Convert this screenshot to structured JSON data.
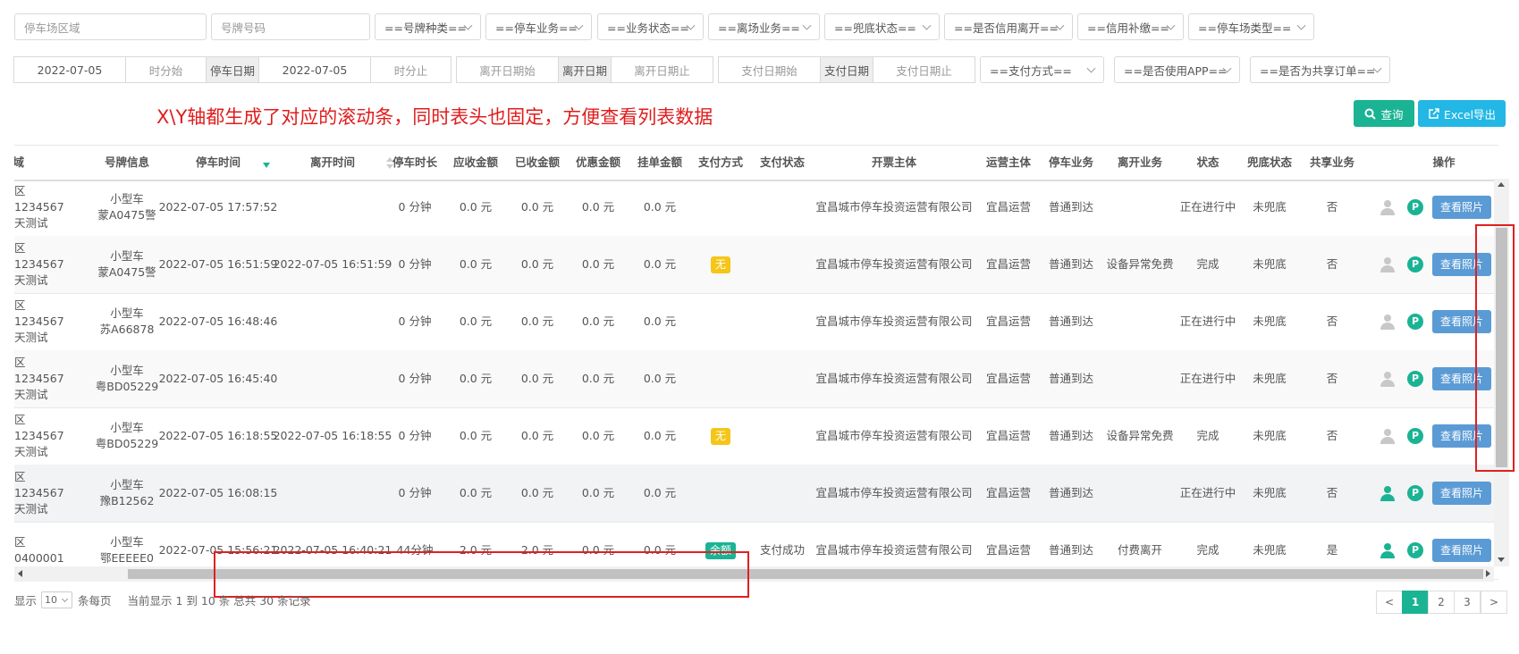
{
  "filters_row1": {
    "parking_area_placeholder": "停车场区域",
    "plate_placeholder": "号牌号码",
    "plate_type": "==号牌种类==",
    "parking_business": "==停车业务==",
    "business_status": "==业务状态==",
    "leave_business": "==离场业务==",
    "bottom_status": "==兜底状态==",
    "credit_leave": "==是否信用离开==",
    "credit_supplement": "==信用补缴==",
    "lot_type": "==停车场类型=="
  },
  "filters_row2": {
    "park_date_start": "2022-07-05",
    "park_time_start_placeholder": "时分始",
    "park_date_label": "停车日期",
    "park_date_end": "2022-07-05",
    "park_time_end_placeholder": "时分止",
    "leave_date_start_placeholder": "离开日期始",
    "leave_date_label": "离开日期",
    "leave_date_end_placeholder": "离开日期止",
    "pay_date_start_placeholder": "支付日期始",
    "pay_date_label": "支付日期",
    "pay_date_end_placeholder": "支付日期止",
    "pay_method": "==支付方式==",
    "use_app": "==是否使用APP==",
    "shared_order": "==是否为共享订单=="
  },
  "toolbar": {
    "query_label": "查询",
    "export_label": "Excel导出"
  },
  "annotation_text": "X\\Y轴都生成了对应的滚动条，同时表头也固定，方便查看列表数据",
  "table": {
    "headers": {
      "area": "区域",
      "plate": "号牌信息",
      "park_time": "停车时间",
      "leave_time": "离开时间",
      "duration": "停车时长",
      "receivable": "应收金额",
      "received": "已收金额",
      "discount": "优惠金额",
      "pending": "挂单金额",
      "pay_method": "支付方式",
      "pay_status": "支付状态",
      "invoice_entity": "开票主体",
      "operator": "运营主体",
      "park_business": "停车业务",
      "leave_business": "离开业务",
      "status": "状态",
      "bottom_status": "兜底状态",
      "shared": "共享业务",
      "action": "操作"
    },
    "rows": [
      {
        "area1": "区",
        "area2": "1234567",
        "area3": "天测试",
        "vehicle": "小型车",
        "plate": "蒙A0475警",
        "park_time": "2022-07-05 17:57:52",
        "leave_time": "",
        "duration": "0 分钟",
        "receivable": "0.0 元",
        "received": "0.0 元",
        "discount": "0.0 元",
        "pending": "0.0 元",
        "pay_tag": "",
        "pay_tag_color": "",
        "pay_status": "",
        "invoice": "宜昌城市停车投资运营有限公司",
        "operator": "宜昌运营",
        "park_business": "普通到达",
        "leave_business": "",
        "status": "正在进行中",
        "bottom_status": "未兜底",
        "shared": "否",
        "user_active": false,
        "photo_label": "查看照片"
      },
      {
        "area1": "区",
        "area2": "1234567",
        "area3": "天测试",
        "vehicle": "小型车",
        "plate": "蒙A0475警",
        "park_time": "2022-07-05 16:51:59",
        "leave_time": "2022-07-05 16:51:59",
        "duration": "0 分钟",
        "receivable": "0.0 元",
        "received": "0.0 元",
        "discount": "0.0 元",
        "pending": "0.0 元",
        "pay_tag": "无",
        "pay_tag_color": "#f5c518",
        "pay_status": "",
        "invoice": "宜昌城市停车投资运营有限公司",
        "operator": "宜昌运营",
        "park_business": "普通到达",
        "leave_business": "设备异常免费",
        "status": "完成",
        "bottom_status": "未兜底",
        "shared": "否",
        "user_active": false,
        "photo_label": "查看照片"
      },
      {
        "area1": "区",
        "area2": "1234567",
        "area3": "天测试",
        "vehicle": "小型车",
        "plate": "苏A66878",
        "park_time": "2022-07-05 16:48:46",
        "leave_time": "",
        "duration": "0 分钟",
        "receivable": "0.0 元",
        "received": "0.0 元",
        "discount": "0.0 元",
        "pending": "0.0 元",
        "pay_tag": "",
        "pay_tag_color": "",
        "pay_status": "",
        "invoice": "宜昌城市停车投资运营有限公司",
        "operator": "宜昌运营",
        "park_business": "普通到达",
        "leave_business": "",
        "status": "正在进行中",
        "bottom_status": "未兜底",
        "shared": "否",
        "user_active": false,
        "photo_label": "查看照片"
      },
      {
        "area1": "区",
        "area2": "1234567",
        "area3": "天测试",
        "vehicle": "小型车",
        "plate": "粤BD05229",
        "park_time": "2022-07-05 16:45:40",
        "leave_time": "",
        "duration": "0 分钟",
        "receivable": "0.0 元",
        "received": "0.0 元",
        "discount": "0.0 元",
        "pending": "0.0 元",
        "pay_tag": "",
        "pay_tag_color": "",
        "pay_status": "",
        "invoice": "宜昌城市停车投资运营有限公司",
        "operator": "宜昌运营",
        "park_business": "普通到达",
        "leave_business": "",
        "status": "正在进行中",
        "bottom_status": "未兜底",
        "shared": "否",
        "user_active": false,
        "photo_label": "查看照片"
      },
      {
        "area1": "区",
        "area2": "1234567",
        "area3": "天测试",
        "vehicle": "小型车",
        "plate": "粤BD05229",
        "park_time": "2022-07-05 16:18:55",
        "leave_time": "2022-07-05 16:18:55",
        "duration": "0 分钟",
        "receivable": "0.0 元",
        "received": "0.0 元",
        "discount": "0.0 元",
        "pending": "0.0 元",
        "pay_tag": "无",
        "pay_tag_color": "#f5c518",
        "pay_status": "",
        "invoice": "宜昌城市停车投资运营有限公司",
        "operator": "宜昌运营",
        "park_business": "普通到达",
        "leave_business": "设备异常免费",
        "status": "完成",
        "bottom_status": "未兜底",
        "shared": "否",
        "user_active": false,
        "photo_label": "查看照片"
      },
      {
        "area1": "区",
        "area2": "1234567",
        "area3": "天测试",
        "vehicle": "小型车",
        "plate": "豫B12562",
        "park_time": "2022-07-05 16:08:15",
        "leave_time": "",
        "duration": "0 分钟",
        "receivable": "0.0 元",
        "received": "0.0 元",
        "discount": "0.0 元",
        "pending": "0.0 元",
        "pay_tag": "",
        "pay_tag_color": "",
        "pay_status": "",
        "invoice": "宜昌城市停车投资运营有限公司",
        "operator": "宜昌运营",
        "park_business": "普通到达",
        "leave_business": "",
        "status": "正在进行中",
        "bottom_status": "未兜底",
        "shared": "否",
        "user_active": true,
        "photo_label": "查看照片"
      },
      {
        "area1": "区",
        "area2": "0400001",
        "area3": "",
        "vehicle": "小型车",
        "plate": "鄂EEEEE0",
        "park_time": "2022-07-05 15:56:21",
        "leave_time": "2022-07-05 16:40:21",
        "duration": "44分钟",
        "receivable": "2.0 元",
        "received": "2.0 元",
        "discount": "0.0 元",
        "pending": "0.0 元",
        "pay_tag": "余额",
        "pay_tag_color": "#1ab394",
        "pay_status": "支付成功",
        "invoice": "宜昌城市停车投资运营有限公司",
        "operator": "宜昌运营",
        "park_business": "普通到达",
        "leave_business": "付费离开",
        "status": "完成",
        "bottom_status": "未兜底",
        "shared": "是",
        "user_active": true,
        "photo_label": "查看照片"
      }
    ]
  },
  "footer": {
    "show_label": "显示",
    "page_size": "10",
    "per_page_label": "条每页",
    "summary": "当前显示 1 到 10 条 总共 30 条记录"
  },
  "pagination": {
    "prev": "<",
    "pages": [
      "1",
      "2",
      "3"
    ],
    "next": ">",
    "active_page": "1"
  },
  "colors": {
    "primary_green": "#1ab394",
    "export_blue": "#23b7e5",
    "annotation_red": "#e01c1c",
    "photo_button": "#5b9bd5"
  }
}
